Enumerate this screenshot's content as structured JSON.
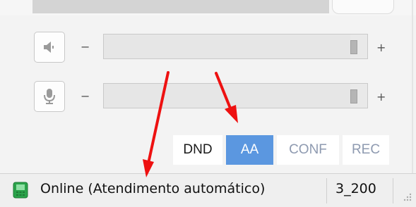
{
  "volume": {
    "minus_label": "−",
    "plus_label": "+",
    "speaker_level": 0.97,
    "mic_level": 0.97
  },
  "modes": {
    "dnd": "DND",
    "aa": "AA",
    "conf": "CONF",
    "rec": "REC"
  },
  "status": {
    "text": "Online (Atendimento automático)",
    "extension": "3_200"
  },
  "colors": {
    "active_button": "#5b97e0",
    "annotation_arrow": "#ee1111",
    "status_icon": "#2aa34a"
  },
  "icons": {
    "speaker": "speaker-icon",
    "microphone": "microphone-icon",
    "status": "phone-status-icon",
    "grip": "resize-grip-icon"
  }
}
